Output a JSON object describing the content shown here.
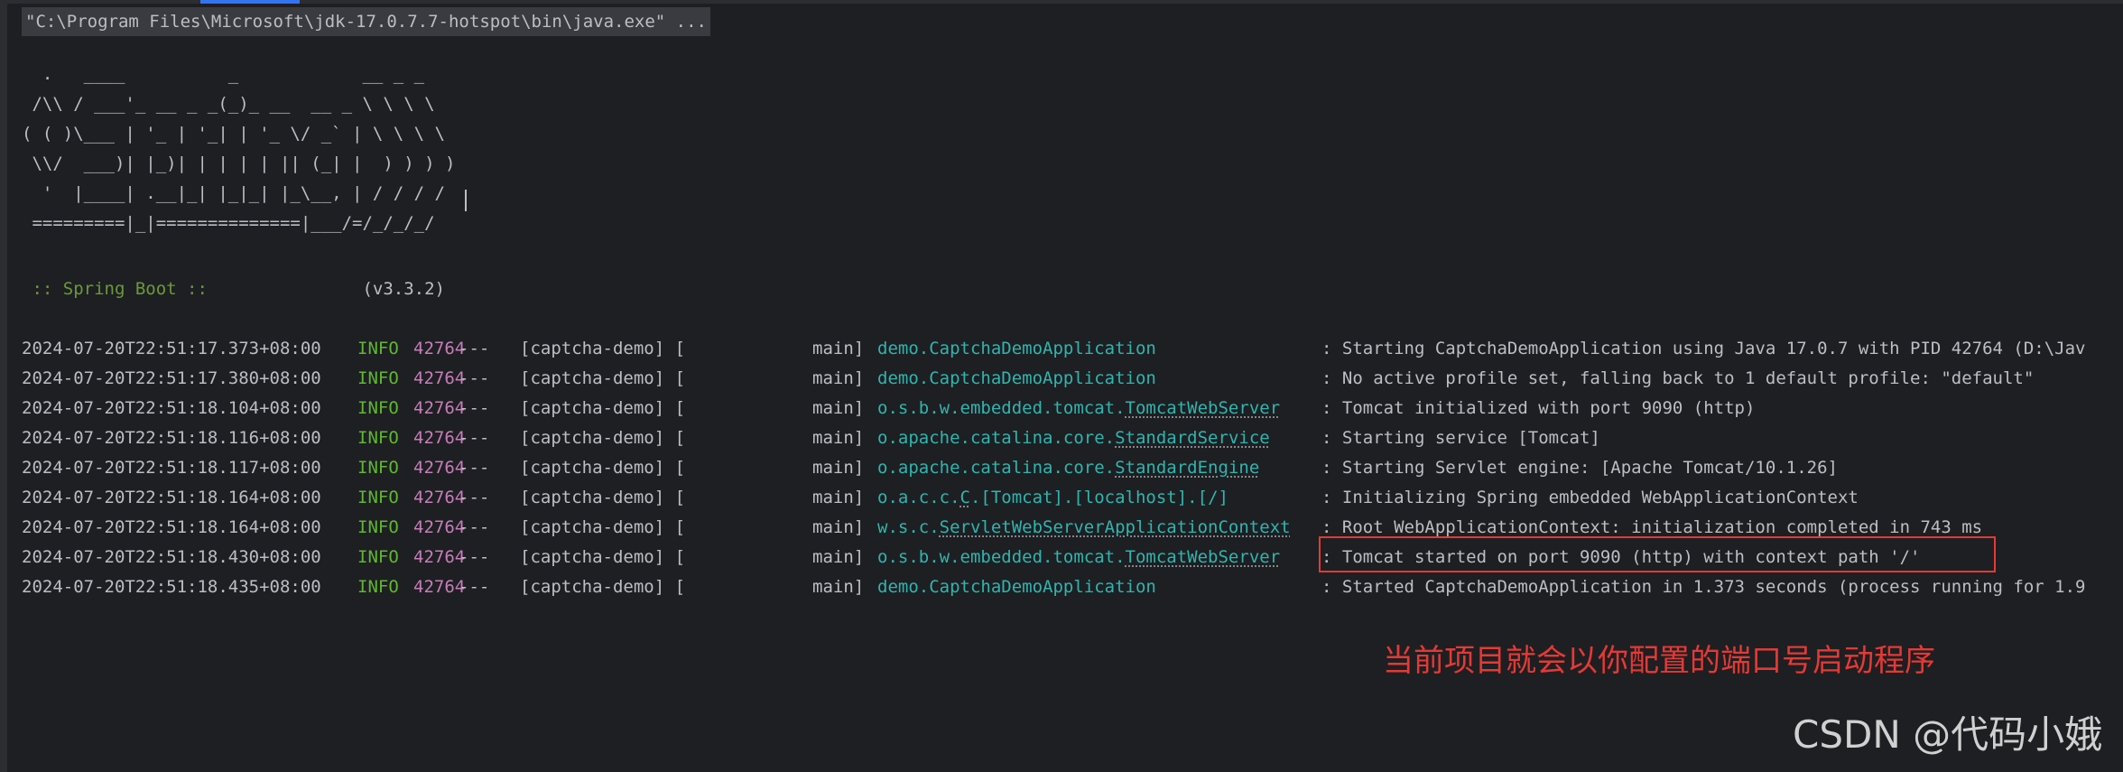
{
  "console": {
    "command": "\"C:\\Program Files\\Microsoft\\jdk-17.0.7.7-hotspot\\bin\\java.exe\" ...",
    "banner": [
      "  .   ____          _            __ _ _",
      " /\\\\ / ___'_ __ _ _(_)_ __  __ _ \\ \\ \\ \\",
      "( ( )\\___ | '_ | '_| | '_ \\/ _` | \\ \\ \\ \\",
      " \\\\/  ___)| |_)| | | | | || (_| |  ) ) ) )",
      "  '  |____| .__|_| |_|_| |_\\__, | / / / /",
      " =========|_|==============|___/=/_/_/_/"
    ],
    "boot_label": " :: Spring Boot :: ",
    "boot_version": "              (v3.3.2)"
  },
  "log_rows": [
    {
      "ts": "2024-07-20T22:51:17.373+08:00",
      "level": "INFO",
      "pid": "42764",
      "sep": "---",
      "app": "[captcha-demo] [",
      "thread": "main]",
      "logger_prefix": "demo.",
      "logger_name": "CaptchaDemoApplication",
      "logger_suffix": "",
      "underline": false,
      "msg": ": Starting CaptchaDemoApplication using Java 17.0.7 with PID 42764 (D:\\Jav"
    },
    {
      "ts": "2024-07-20T22:51:17.380+08:00",
      "level": "INFO",
      "pid": "42764",
      "sep": "---",
      "app": "[captcha-demo] [",
      "thread": "main]",
      "logger_prefix": "demo.",
      "logger_name": "CaptchaDemoApplication",
      "logger_suffix": "",
      "underline": false,
      "msg": ": No active profile set, falling back to 1 default profile: \"default\""
    },
    {
      "ts": "2024-07-20T22:51:18.104+08:00",
      "level": "INFO",
      "pid": "42764",
      "sep": "---",
      "app": "[captcha-demo] [",
      "thread": "main]",
      "logger_prefix": "o.s.b.w.embedded.tomcat.",
      "logger_name": "TomcatWebServer",
      "logger_suffix": "",
      "underline": true,
      "msg": ": Tomcat initialized with port 9090 (http)"
    },
    {
      "ts": "2024-07-20T22:51:18.116+08:00",
      "level": "INFO",
      "pid": "42764",
      "sep": "---",
      "app": "[captcha-demo] [",
      "thread": "main]",
      "logger_prefix": "o.apache.catalina.core.",
      "logger_name": "StandardService",
      "logger_suffix": "",
      "underline": true,
      "msg": ": Starting service [Tomcat]"
    },
    {
      "ts": "2024-07-20T22:51:18.117+08:00",
      "level": "INFO",
      "pid": "42764",
      "sep": "---",
      "app": "[captcha-demo] [",
      "thread": "main]",
      "logger_prefix": "o.apache.catalina.core.",
      "logger_name": "StandardEngine",
      "logger_suffix": "",
      "underline": true,
      "msg": ": Starting Servlet engine: [Apache Tomcat/10.1.26]"
    },
    {
      "ts": "2024-07-20T22:51:18.164+08:00",
      "level": "INFO",
      "pid": "42764",
      "sep": "---",
      "app": "[captcha-demo] [",
      "thread": "main]",
      "logger_prefix": "o.a.c.c.",
      "logger_name": "C",
      "logger_suffix": ".[Tomcat].[localhost].[/]",
      "underline": true,
      "msg": ": Initializing Spring embedded WebApplicationContext"
    },
    {
      "ts": "2024-07-20T22:51:18.164+08:00",
      "level": "INFO",
      "pid": "42764",
      "sep": "---",
      "app": "[captcha-demo] [",
      "thread": "main]",
      "logger_prefix": "w.s.c.",
      "logger_name": "ServletWebServerApplicationContext",
      "logger_suffix": "",
      "underline": true,
      "msg": ": Root WebApplicationContext: initialization completed in 743 ms"
    },
    {
      "ts": "2024-07-20T22:51:18.430+08:00",
      "level": "INFO",
      "pid": "42764",
      "sep": "---",
      "app": "[captcha-demo] [",
      "thread": "main]",
      "logger_prefix": "o.s.b.w.embedded.tomcat.",
      "logger_name": "TomcatWebServer",
      "logger_suffix": "",
      "underline": true,
      "msg": ": Tomcat started on port 9090 (http) with context path '/'"
    },
    {
      "ts": "2024-07-20T22:51:18.435+08:00",
      "level": "INFO",
      "pid": "42764",
      "sep": "---",
      "app": "[captcha-demo] [",
      "thread": "main]",
      "logger_prefix": "demo.",
      "logger_name": "CaptchaDemoApplication",
      "logger_suffix": "",
      "underline": false,
      "msg": ": Started CaptchaDemoApplication in 1.373 seconds (process running for 1.9"
    }
  ],
  "annotation": "当前项目就会以你配置的端口号启动程序",
  "watermark": "CSDN @代码小娥",
  "colors": {
    "background": "#1e1f22",
    "info_level": "#5fb832",
    "pid": "#c77dbb",
    "logger": "#2fb5b0",
    "boot_label": "#6a9a3a",
    "highlight": "#e53935"
  }
}
